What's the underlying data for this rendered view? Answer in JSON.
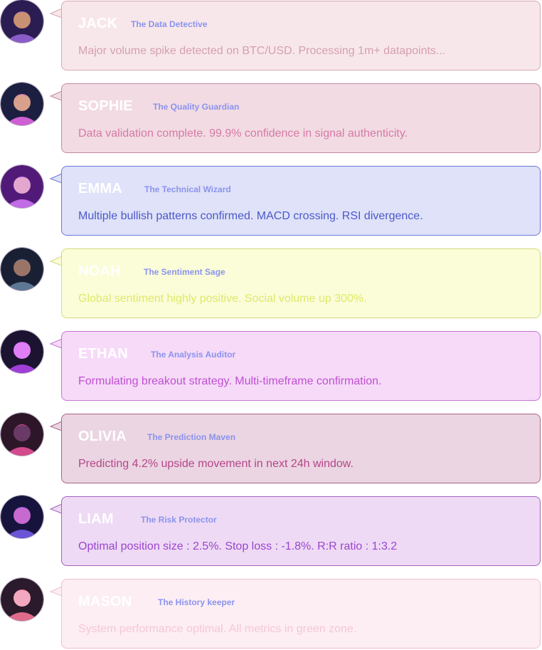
{
  "agents": [
    {
      "name": "JACK",
      "role": "The Data Detective",
      "message": "Major volume spike detected on BTC/USD. Processing 1m+ datapoints...",
      "bubble_bg": "#f8e7ea",
      "bubble_border": "#d6a6b7",
      "text_color": "#d3a0b2",
      "avatar_colors": [
        "#2b1d52",
        "#8a5cc7",
        "#c99173"
      ]
    },
    {
      "name": "SOPHIE",
      "role": "The Quality Guardian",
      "message": "Data validation complete. 99.9% confidence in signal authenticity.",
      "bubble_bg": "#f2dbe3",
      "bubble_border": "#c28aa4",
      "text_color": "#d67aa6",
      "avatar_colors": [
        "#1c1f3f",
        "#cf5fd4",
        "#d8a08d"
      ]
    },
    {
      "name": "EMMA",
      "role": "The Technical Wizard",
      "message": "Multiple bullish patterns confirmed. MACD crossing. RSI divergence.",
      "bubble_bg": "#dfe2f8",
      "bubble_border": "#6c78d8",
      "text_color": "#4c58c9",
      "avatar_colors": [
        "#521a78",
        "#c16be6",
        "#e3a6cf"
      ]
    },
    {
      "name": "NOAH",
      "role": "The Sentiment Sage",
      "message": "Global sentiment highly positive. Social volume up 300%.",
      "bubble_bg": "#fbfdd8",
      "bubble_border": "#d4d87d",
      "text_color": "#dfe86a",
      "avatar_colors": [
        "#1a2034",
        "#5e7794",
        "#9b7468"
      ]
    },
    {
      "name": "ETHAN",
      "role": "The Analysis Auditor",
      "message": "Formulating breakout strategy. Multi-timeframe confirmation.",
      "bubble_bg": "#f6daf8",
      "bubble_border": "#c875d5",
      "text_color": "#c04fd2",
      "avatar_colors": [
        "#1c1330",
        "#a03fd8",
        "#e07ff5"
      ]
    },
    {
      "name": "OLIVIA",
      "role": "The Prediction Maven",
      "message": "Predicting 4.2% upside movement in next 24h window.",
      "bubble_bg": "#ebd5e2",
      "bubble_border": "#aa6487",
      "text_color": "#b4468a",
      "avatar_colors": [
        "#2d1628",
        "#d34a8d",
        "#6a3a66"
      ]
    },
    {
      "name": "LIAM",
      "role": "The Risk Protector",
      "message": "Optimal position size : 2.5%. Stop loss : -1.8%. R:R ratio : 1:3.2",
      "bubble_bg": "#eedaf4",
      "bubble_border": "#a263bd",
      "text_color": "#9a46ce",
      "avatar_colors": [
        "#16143c",
        "#6b55d6",
        "#c76ad0"
      ]
    },
    {
      "name": "MASON",
      "role": "The History keeper",
      "message": "System performance optimal. All metrics in green zone.",
      "bubble_bg": "#fdeef3",
      "bubble_border": "#efbfd0",
      "text_color": "#f5c7d8",
      "avatar_colors": [
        "#2a1a2b",
        "#e06a8a",
        "#f4a7c0"
      ]
    }
  ]
}
